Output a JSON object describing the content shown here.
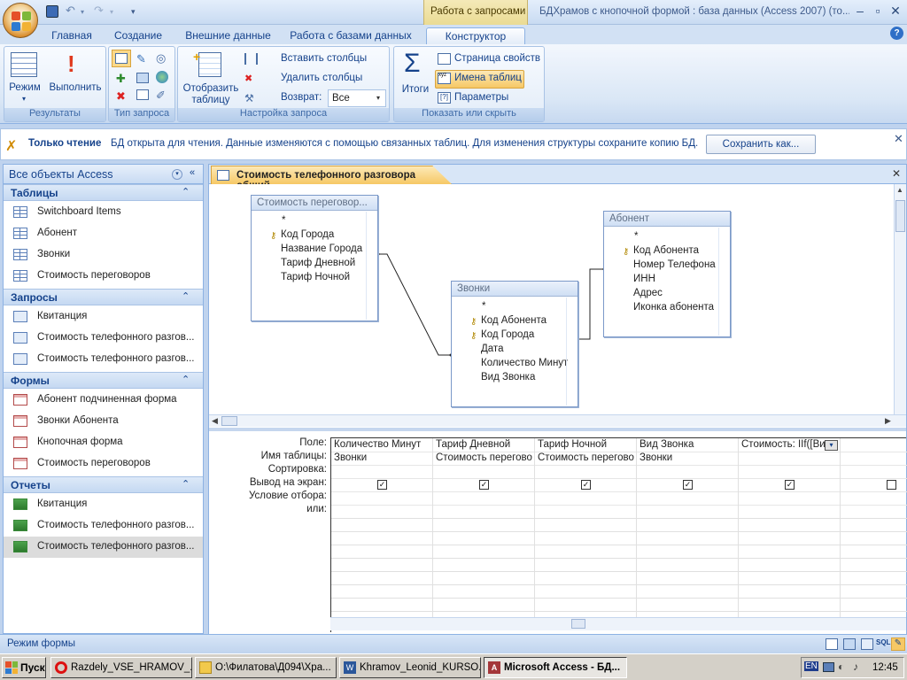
{
  "window": {
    "title": "БДХрамов с кнопочной формой : база данных (Access 2007) (то...",
    "context_tab": "Работа с запросами"
  },
  "ribbon": {
    "tabs": [
      "Главная",
      "Создание",
      "Внешние данные",
      "Работа с базами данных",
      "Конструктор"
    ],
    "active_tab": "Конструктор",
    "groups": {
      "results": {
        "label": "Результаты",
        "view_label": "Режим",
        "run_label": "Выполнить"
      },
      "query_type": {
        "label": "Тип запроса"
      },
      "query_setup": {
        "label": "Настройка запроса",
        "show_table_label": "Отобразить таблицу",
        "insert_columns_label": "Вставить столбцы",
        "delete_columns_label": "Удалить столбцы",
        "return_label": "Возврат:",
        "return_value": "Все"
      },
      "show_hide": {
        "label": "Показать или скрыть",
        "totals_label": "Итоги",
        "property_sheet_label": "Страница свойств",
        "table_names_label": "Имена таблиц",
        "parameters_label": "Параметры"
      }
    }
  },
  "message_bar": {
    "title": "Только чтение",
    "text": "БД открыта для чтения. Данные изменяются с помощью связанных таблиц. Для изменения структуры сохраните копию БД.",
    "button_label": "Сохранить как..."
  },
  "nav": {
    "header": "Все объекты Access",
    "sections": [
      {
        "title": "Таблицы",
        "kind": "table",
        "items": [
          "Switchboard Items",
          "Абонент",
          "Звонки",
          "Стоимость переговоров"
        ]
      },
      {
        "title": "Запросы",
        "kind": "query",
        "items": [
          "Квитанция",
          "Стоимость телефонного разгов...",
          "Стоимость телефонного разгов..."
        ]
      },
      {
        "title": "Формы",
        "kind": "form",
        "items": [
          "Абонент подчиненная форма",
          "Звонки Абонента",
          "Кнопочная форма",
          "Стоимость переговоров"
        ]
      },
      {
        "title": "Отчеты",
        "kind": "report",
        "items": [
          "Квитанция",
          "Стоимость телефонного разгов...",
          "Стоимость телефонного разгов..."
        ]
      }
    ],
    "selected": "Стоимость телефонного разгов..."
  },
  "document": {
    "tab_title": "Стоимость телефонного разговора общий",
    "tables": [
      {
        "title": "Стоимость переговор...",
        "fields": [
          "*",
          "Код Города",
          "Название Города",
          "Тариф Дневной",
          "Тариф Ночной"
        ],
        "keys": [
          false,
          true,
          false,
          false,
          false
        ]
      },
      {
        "title": "Звонки",
        "fields": [
          "*",
          "Код Абонента",
          "Код Города",
          "Дата",
          "Количество Минут",
          "Вид Звонка"
        ],
        "keys": [
          false,
          true,
          true,
          false,
          false,
          false
        ]
      },
      {
        "title": "Абонент",
        "fields": [
          "*",
          "Код Абонента",
          "Номер Телефона",
          "ИНН",
          "Адрес",
          "Иконка абонента"
        ],
        "keys": [
          false,
          true,
          false,
          false,
          false,
          false
        ]
      }
    ]
  },
  "grid": {
    "row_labels": [
      "Поле:",
      "Имя таблицы:",
      "Сортировка:",
      "Вывод на экран:",
      "Условие отбора:",
      "или:"
    ],
    "columns": [
      {
        "field": "Количество Минут",
        "table": "Звонки",
        "show": true
      },
      {
        "field": "Тариф Дневной",
        "table": "Стоимость перегово",
        "show": true
      },
      {
        "field": "Тариф Ночной",
        "table": "Стоимость перегово",
        "show": true
      },
      {
        "field": "Вид Звонка",
        "table": "Звонки",
        "show": true
      },
      {
        "field": "Стоимость: IIf([Ви",
        "table": "",
        "show": true
      },
      {
        "field": "",
        "table": "",
        "show": false
      }
    ]
  },
  "status": {
    "text": "Режим формы"
  },
  "taskbar": {
    "start_label": "Пуск",
    "tasks": [
      "Razdely_VSE_HRAMOV_...",
      "О:\\Филатова\\Д094\\Хра...",
      "Khramov_Leonid_KURSO...",
      "Microsoft Access - БД..."
    ],
    "active_task": "Microsoft Access - БД...",
    "language": "EN",
    "clock": "12:45"
  },
  "colors": {
    "accent": "#15428b",
    "context_tab": "#eadb94",
    "doc_tab": "#f6c865"
  }
}
